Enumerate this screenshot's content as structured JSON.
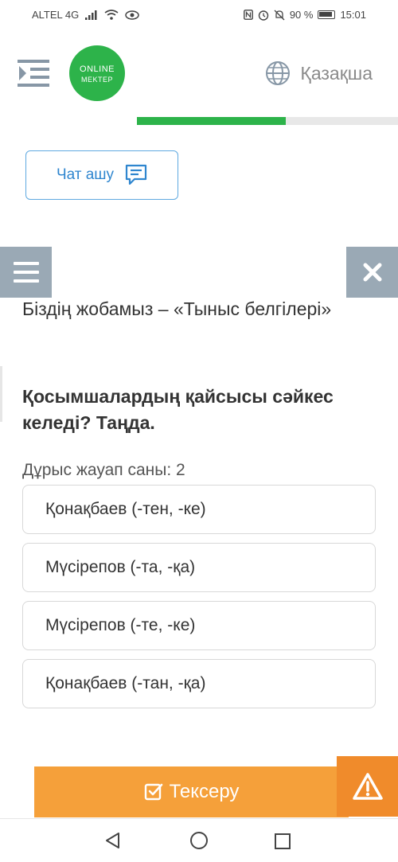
{
  "status_bar": {
    "carrier": "ALTEL 4G",
    "battery": "90 %",
    "time": "15:01"
  },
  "header": {
    "logo_line1": "ONLINE",
    "logo_line2": "MEKTEP",
    "language": "Қазақша",
    "progress_fraction": 0.57
  },
  "chat": {
    "label": "Чат ашу"
  },
  "content": {
    "project_title": "Біздің жобамыз – «Тыныс белгілері»",
    "question": "Қосымшалардың қайсысы сәйкес келеді? Таңда.",
    "answer_count": "Дұрыс жауап саны: 2",
    "options": [
      "Қонақбаев (-тен, -ке)",
      "Мүсірепов (-та, -қа)",
      "Мүсірепов (-те, -ке)",
      "Қонақбаев (-тан, -қа)"
    ]
  },
  "footer": {
    "check_label": "Тексеру"
  },
  "colors": {
    "brand_green": "#2db34a",
    "chat_blue": "#2f86cf",
    "check_orange": "#f5a03a",
    "warning_orange": "#f08b2b",
    "side_button_gray": "#9aa9b5"
  }
}
